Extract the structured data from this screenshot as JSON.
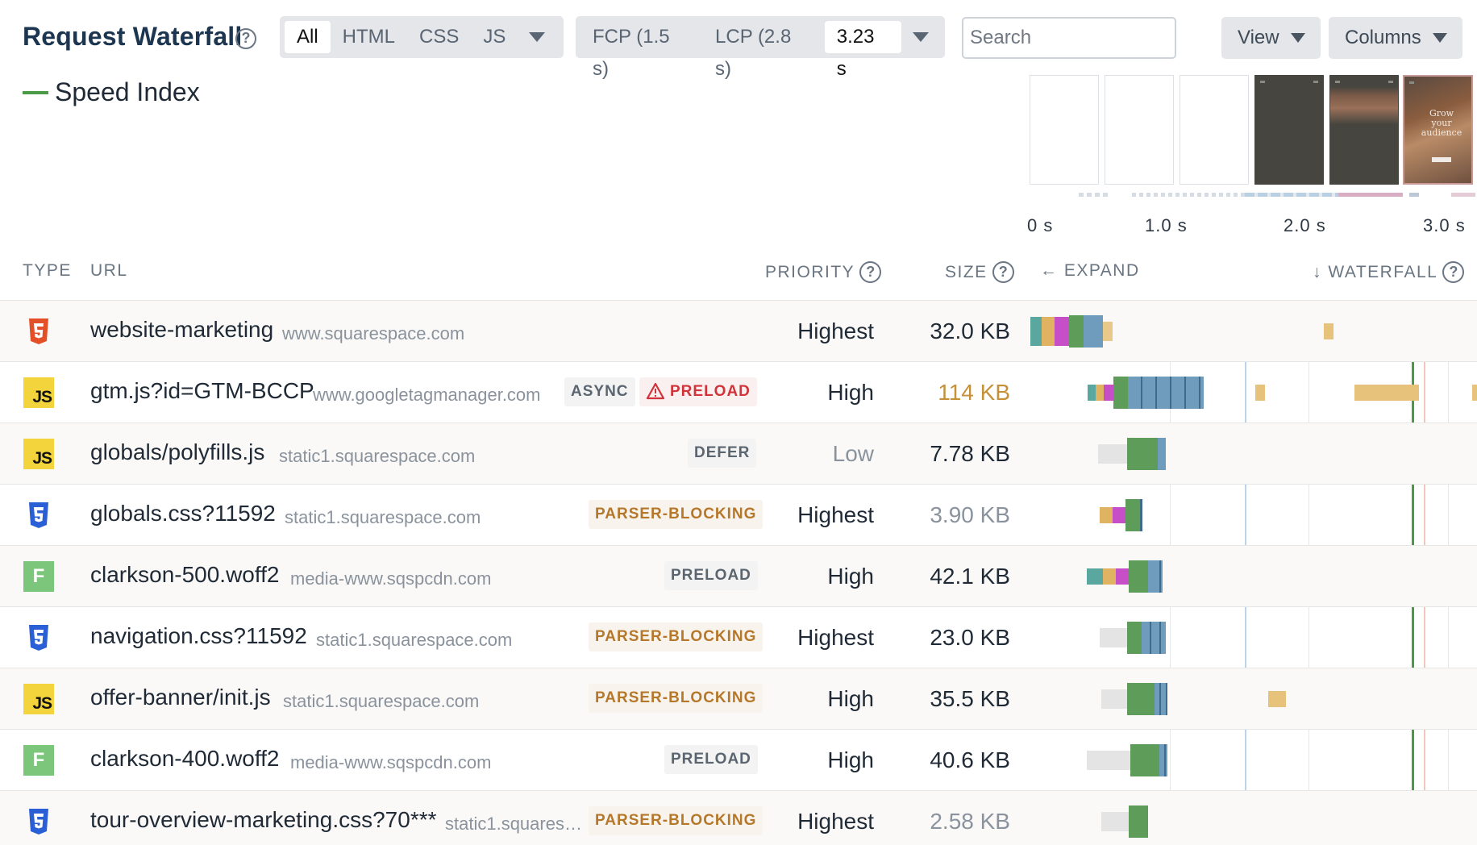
{
  "header": {
    "title": "Request Waterfall",
    "help_glyph": "?",
    "type_filters": [
      "All",
      "HTML",
      "CSS",
      "JS"
    ],
    "active_type": "All",
    "time_markers": [
      "FCP (1.5 s)",
      "LCP (2.8 s)",
      "3.23 s"
    ],
    "search_placeholder": "Search",
    "view_label": "View",
    "columns_label": "Columns"
  },
  "legend": {
    "label": "Speed Index",
    "color": "#4b9a47"
  },
  "filmstrip": {
    "frames": [
      "blank",
      "blank",
      "blank",
      "dark",
      "dark",
      "photo"
    ],
    "frame_text": "Grow your audience"
  },
  "axis": {
    "labels": [
      "0 s",
      "1.0 s",
      "2.0 s",
      "3.0 s"
    ]
  },
  "columns": {
    "type": "TYPE",
    "url": "URL",
    "priority": "PRIORITY",
    "size": "SIZE",
    "expand": "← EXPAND",
    "waterfall": "↓ WATERFALL"
  },
  "rows": [
    {
      "type": "html",
      "url": "website-marketing",
      "host": "www.squarespace.com",
      "badges": [],
      "priority": "Highest",
      "size": "32.0 KB"
    },
    {
      "type": "js",
      "url": "gtm.js?id=GTM-BCCP",
      "host": "www.googletagmanager.com",
      "badges": [
        "ASYNC",
        "PRELOAD"
      ],
      "priority": "High",
      "size": "114 KB"
    },
    {
      "type": "js",
      "url": "globals/polyfills.js",
      "host": "static1.squarespace.com",
      "badges": [
        "DEFER"
      ],
      "priority": "Low",
      "size": "7.78 KB"
    },
    {
      "type": "css",
      "url": "globals.css?11592",
      "host": "static1.squarespace.com",
      "badges": [
        "PARSER-BLOCKING"
      ],
      "priority": "Highest",
      "size": "3.90 KB"
    },
    {
      "type": "font",
      "url": "clarkson-500.woff2",
      "host": "media-www.sqspcdn.com",
      "badges": [
        "PRELOAD"
      ],
      "priority": "High",
      "size": "42.1 KB"
    },
    {
      "type": "css",
      "url": "navigation.css?11592",
      "host": "static1.squarespace.com",
      "badges": [
        "PARSER-BLOCKING"
      ],
      "priority": "Highest",
      "size": "23.0 KB"
    },
    {
      "type": "js",
      "url": "offer-banner/init.js",
      "host": "static1.squarespace.com",
      "badges": [
        "PARSER-BLOCKING"
      ],
      "priority": "High",
      "size": "35.5 KB"
    },
    {
      "type": "font",
      "url": "clarkson-400.woff2",
      "host": "media-www.sqspcdn.com",
      "badges": [
        "PRELOAD"
      ],
      "priority": "High",
      "size": "40.6 KB"
    },
    {
      "type": "css",
      "url": "tour-overview-marketing.css?70***",
      "host": "static1.squares…",
      "badges": [
        "PARSER-BLOCKING"
      ],
      "priority": "Highest",
      "size": "2.58 KB"
    }
  ],
  "icons": {
    "js_label": "JS",
    "font_label": "F",
    "warning": "warning-triangle-icon"
  },
  "colors": {
    "dns": "#5aa7a0",
    "connect": "#e0b363",
    "ssl": "#c64fc8",
    "ttfb": "#5d9c59",
    "download": "#6f9bbd",
    "wait": "#e4e4e4",
    "fcp_line": "#bcd3ea",
    "speed_index": "#4b9a47",
    "lcp_line": "#f0c8bd"
  }
}
